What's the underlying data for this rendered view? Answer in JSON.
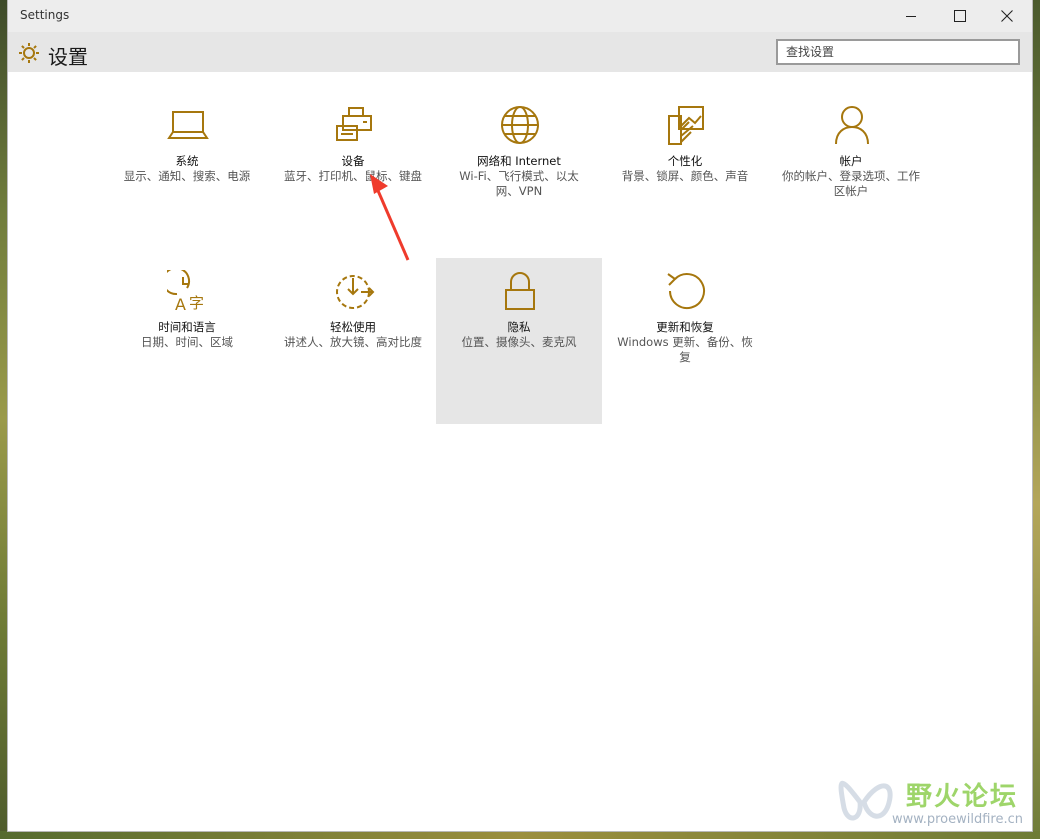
{
  "window": {
    "title": "Settings",
    "controls": {
      "minimize": "minimize",
      "maximize": "maximize",
      "close": "close"
    }
  },
  "header": {
    "title": "设置",
    "search_placeholder": "查找设置"
  },
  "accent_color": "#a6770e",
  "tiles": [
    {
      "title": "系统",
      "desc": "显示、通知、搜索、电源",
      "icon": "laptop-icon"
    },
    {
      "title": "设备",
      "desc": "蓝牙、打印机、鼠标、键盘",
      "icon": "printer-icon"
    },
    {
      "title": "网络和 Internet",
      "desc": "Wi-Fi、飞行模式、以太网、VPN",
      "icon": "globe-icon"
    },
    {
      "title": "个性化",
      "desc": "背景、锁屏、颜色、声音",
      "icon": "palette-icon"
    },
    {
      "title": "帐户",
      "desc": "你的帐户、登录选项、工作区帐户",
      "icon": "person-icon"
    },
    {
      "title": "时间和语言",
      "desc": "日期、时间、区域",
      "icon": "clock-language-icon"
    },
    {
      "title": "轻松使用",
      "desc": "讲述人、放大镜、高对比度",
      "icon": "ease-of-access-icon"
    },
    {
      "title": "隐私",
      "desc": "位置、摄像头、麦克风",
      "icon": "lock-icon"
    },
    {
      "title": "更新和恢复",
      "desc": "Windows 更新、备份、恢复",
      "icon": "refresh-icon"
    }
  ],
  "watermark": {
    "title": "野火论坛",
    "url": "www.proewildfire.cn"
  }
}
